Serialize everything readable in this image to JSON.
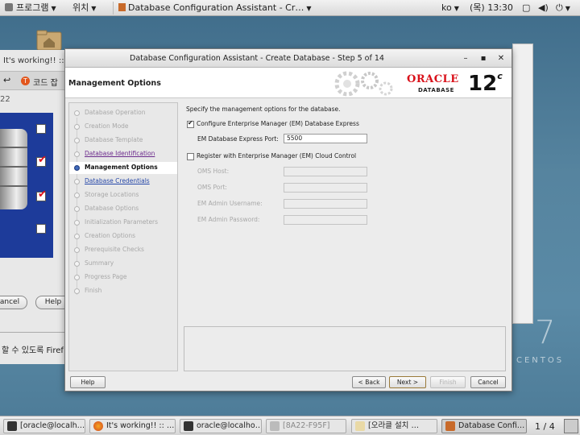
{
  "topbar": {
    "programs": "프로그램",
    "places": "위치",
    "active_window": "Database Configuration Assistant - Cr…",
    "lang": "ko",
    "clock": "(목) 13:30"
  },
  "bg_window": {
    "title": "It's working!! :: c",
    "tab_label": "코드 잡",
    "url": "22",
    "cancel_label": "ancel",
    "help_label": "Help",
    "bottom_text": "할 수 있도록 Firef"
  },
  "desktop": {
    "logo_number": "7",
    "logo_text": "CENTOS"
  },
  "dialog": {
    "title": "Database Configuration Assistant - Create Database - Step 5 of 14",
    "heading": "Management Options",
    "oracle": "ORACLE",
    "database": "DATABASE",
    "version": "12",
    "version_suffix": "c"
  },
  "steps": [
    {
      "label": "Database Operation"
    },
    {
      "label": "Creation Mode"
    },
    {
      "label": "Database Template"
    },
    {
      "label": "Database Identification"
    },
    {
      "label": "Management Options"
    },
    {
      "label": "Database Credentials"
    },
    {
      "label": "Storage Locations"
    },
    {
      "label": "Database Options"
    },
    {
      "label": "Initialization Parameters"
    },
    {
      "label": "Creation Options"
    },
    {
      "label": "Prerequisite Checks"
    },
    {
      "label": "Summary"
    },
    {
      "label": "Progress Page"
    },
    {
      "label": "Finish"
    }
  ],
  "content": {
    "intro": "Specify the management options for the database.",
    "em_express_label": "Configure Enterprise Manager (EM) Database Express",
    "em_port_label": "EM Database Express Port:",
    "em_port_value": "5500",
    "cloud_label": "Register with Enterprise Manager (EM) Cloud Control",
    "oms_host_label": "OMS Host:",
    "oms_port_label": "OMS Port:",
    "em_admin_user_label": "EM Admin Username:",
    "em_admin_pwd_label": "EM Admin Password:"
  },
  "buttons": {
    "help": "Help",
    "back": "< Back",
    "next": "Next >",
    "finish": "Finish",
    "cancel": "Cancel"
  },
  "taskbar": {
    "items": [
      "[oracle@localh…",
      "It's working!! :: …",
      "oracle@localho…",
      "[8A22-F95F]",
      "[오라클 설치 …",
      "Database Confi…"
    ],
    "pager": "1 / 4"
  }
}
